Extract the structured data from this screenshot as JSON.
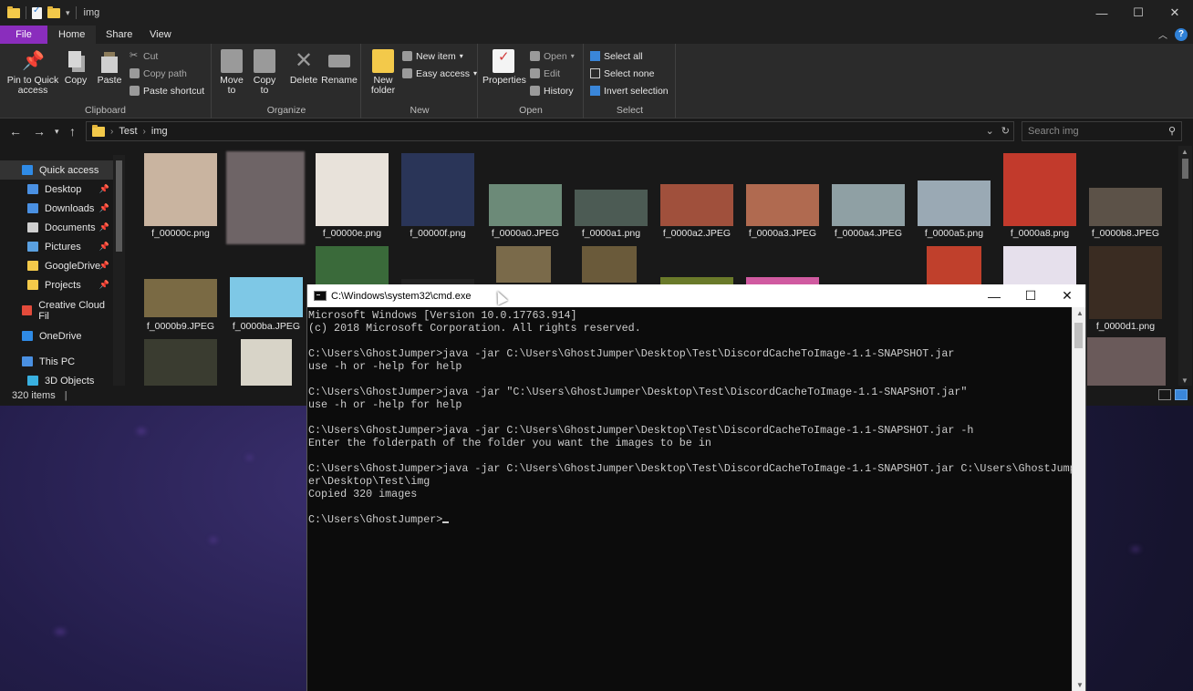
{
  "explorer": {
    "window_title": "img",
    "tabs": {
      "file": "File",
      "home": "Home",
      "share": "Share",
      "view": "View"
    },
    "ribbon": {
      "clipboard": {
        "label": "Clipboard",
        "pin": "Pin to Quick access",
        "copy": "Copy",
        "paste": "Paste",
        "cut": "Cut",
        "copy_path": "Copy path",
        "paste_shortcut": "Paste shortcut"
      },
      "organize": {
        "label": "Organize",
        "move_to": "Move to",
        "copy_to": "Copy to",
        "delete": "Delete",
        "rename": "Rename"
      },
      "new": {
        "label": "New",
        "new_folder": "New folder",
        "new_item": "New item",
        "easy_access": "Easy access"
      },
      "open": {
        "label": "Open",
        "properties": "Properties",
        "open": "Open",
        "edit": "Edit",
        "history": "History"
      },
      "select": {
        "label": "Select",
        "select_all": "Select all",
        "select_none": "Select none",
        "invert": "Invert selection"
      }
    },
    "address": {
      "crumb1": "Test",
      "crumb2": "img"
    },
    "search": {
      "placeholder": "Search img"
    },
    "nav": [
      {
        "label": "Quick access",
        "color": "#2f8be6"
      },
      {
        "label": "Desktop",
        "color": "#4a90e2"
      },
      {
        "label": "Downloads",
        "color": "#4a90e2"
      },
      {
        "label": "Documents",
        "color": "#cfcfcf"
      },
      {
        "label": "Pictures",
        "color": "#5aa0e0"
      },
      {
        "label": "GoogleDrive",
        "color": "#f3c94a"
      },
      {
        "label": "Projects",
        "color": "#f3c94a"
      },
      {
        "label": "Creative Cloud Fil",
        "color": "#e34b3b"
      },
      {
        "label": "OneDrive",
        "color": "#2f8be6"
      },
      {
        "label": "This PC",
        "color": "#4a90e2"
      },
      {
        "label": "3D Objects",
        "color": "#39b0e0"
      }
    ],
    "files": [
      {
        "name": "f_00000c.png",
        "color": "#c9b4a0"
      },
      {
        "name": "",
        "color": "#6e6466"
      },
      {
        "name": "f_00000e.png",
        "color": "#e8e2da"
      },
      {
        "name": "f_00000f.png",
        "color": "#2a3558"
      },
      {
        "name": "f_0000a0.JPEG",
        "color": "#6c8a78"
      },
      {
        "name": "f_0000a1.png",
        "color": "#4c5b54"
      },
      {
        "name": "f_0000a2.JPEG",
        "color": "#a0503c"
      },
      {
        "name": "f_0000a3.JPEG",
        "color": "#b06a50"
      },
      {
        "name": "f_0000a4.JPEG",
        "color": "#8fa0a4"
      },
      {
        "name": "f_0000a5.png",
        "color": "#9aa9b4"
      },
      {
        "name": "f_0000a8.png",
        "color": "#c23a2c"
      },
      {
        "name": "f_0000b8.JPEG",
        "color": "#5c5248"
      },
      {
        "name": "f_0000b9.JPEG",
        "color": "#7a6a44"
      },
      {
        "name": "f_0000ba.JPEG",
        "color": "#7ec8e6"
      },
      {
        "name": "f_0000d1.png",
        "color": "#3a2c22"
      }
    ],
    "status": {
      "count": "320 items"
    }
  },
  "cmd": {
    "title": "C:\\Windows\\system32\\cmd.exe",
    "lines": [
      "Microsoft Windows [Version 10.0.17763.914]",
      "(c) 2018 Microsoft Corporation. All rights reserved.",
      "",
      "C:\\Users\\GhostJumper>java -jar C:\\Users\\GhostJumper\\Desktop\\Test\\DiscordCacheToImage-1.1-SNAPSHOT.jar",
      "use -h or -help for help",
      "",
      "C:\\Users\\GhostJumper>java -jar \"C:\\Users\\GhostJumper\\Desktop\\Test\\DiscordCacheToImage-1.1-SNAPSHOT.jar\"",
      "use -h or -help for help",
      "",
      "C:\\Users\\GhostJumper>java -jar C:\\Users\\GhostJumper\\Desktop\\Test\\DiscordCacheToImage-1.1-SNAPSHOT.jar -h",
      "Enter the folderpath of the folder you want the images to be in",
      "",
      "C:\\Users\\GhostJumper>java -jar C:\\Users\\GhostJumper\\Desktop\\Test\\DiscordCacheToImage-1.1-SNAPSHOT.jar C:\\Users\\GhostJump",
      "er\\Desktop\\Test\\img",
      "Copied 320 images",
      "",
      "C:\\Users\\GhostJumper>"
    ]
  }
}
